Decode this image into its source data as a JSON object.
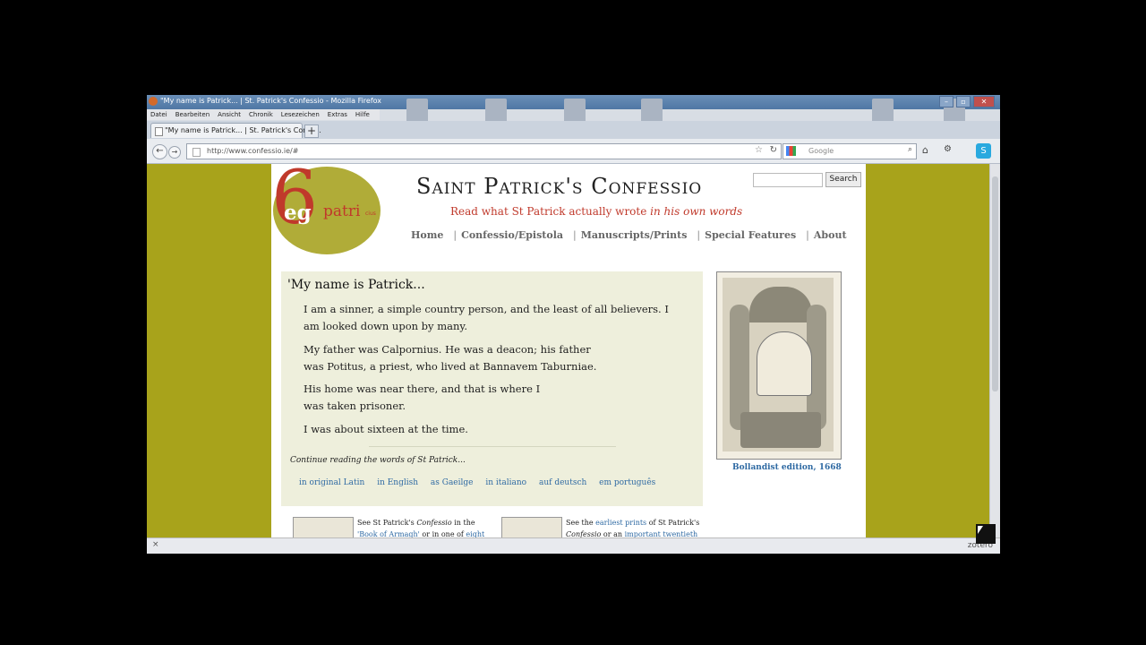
{
  "browser": {
    "window_title": "\"My name is Patrick... | St. Patrick's Confessio - Mozilla Firefox",
    "menu": [
      "Datei",
      "Bearbeiten",
      "Ansicht",
      "Chronik",
      "Lesezeichen",
      "Extras",
      "Hilfe"
    ],
    "tab_title": "\"My name is Patrick... | St. Patrick's Confe...",
    "new_tab": "+",
    "url": "http://www.confessio.ie/#",
    "search_placeholder": "Google",
    "status_close": "×",
    "status_right": "zotero"
  },
  "site": {
    "title": "Saint Patrick's Confessio",
    "tagline": "Read what St Patrick actually wrote",
    "tagline_em": "in his own words",
    "logo_six": "6",
    "logo_eg": "eg",
    "logo_patri": "patri",
    "logo_small": "cius",
    "search_button": "Search",
    "nav": [
      "Home",
      "Confessio/Epistola",
      "Manuscripts/Prints",
      "Special Features",
      "About"
    ],
    "nav_sep": "|"
  },
  "intro": {
    "heading": "'My name is Patrick...",
    "paragraphs": [
      "I am a sinner, a simple country person, and the least of all believers. I am looked down upon by many.",
      "My father was Calpornius. He was a deacon; his father was Potitus, a priest, who lived at Bannavem Taburniae.",
      "His home was near there, and that is where I was taken prisoner.",
      "I was about sixteen at the time."
    ],
    "continue": "Continue reading the words of St Patrick...",
    "languages": [
      "in original Latin",
      "in English",
      "as Gaeilge",
      "in italiano",
      "auf deutsch",
      "em português"
    ]
  },
  "plate": {
    "caption": "Bollandist edition, 1668"
  },
  "bottom": {
    "left": {
      "a": "See St Patrick's",
      "b": "Confessio",
      "c": "in the",
      "d": "'Book of Armagh'",
      "e": "or in one of",
      "f": "eight"
    },
    "right": {
      "a": "See the",
      "b": "earliest prints",
      "c": "of St Patrick's",
      "d": "Confessio",
      "e": "or an",
      "f": "important twentieth"
    }
  },
  "colors": {
    "page_bg": "#a8a31b",
    "accent": "#c0392b",
    "link": "#2f6aa3"
  }
}
